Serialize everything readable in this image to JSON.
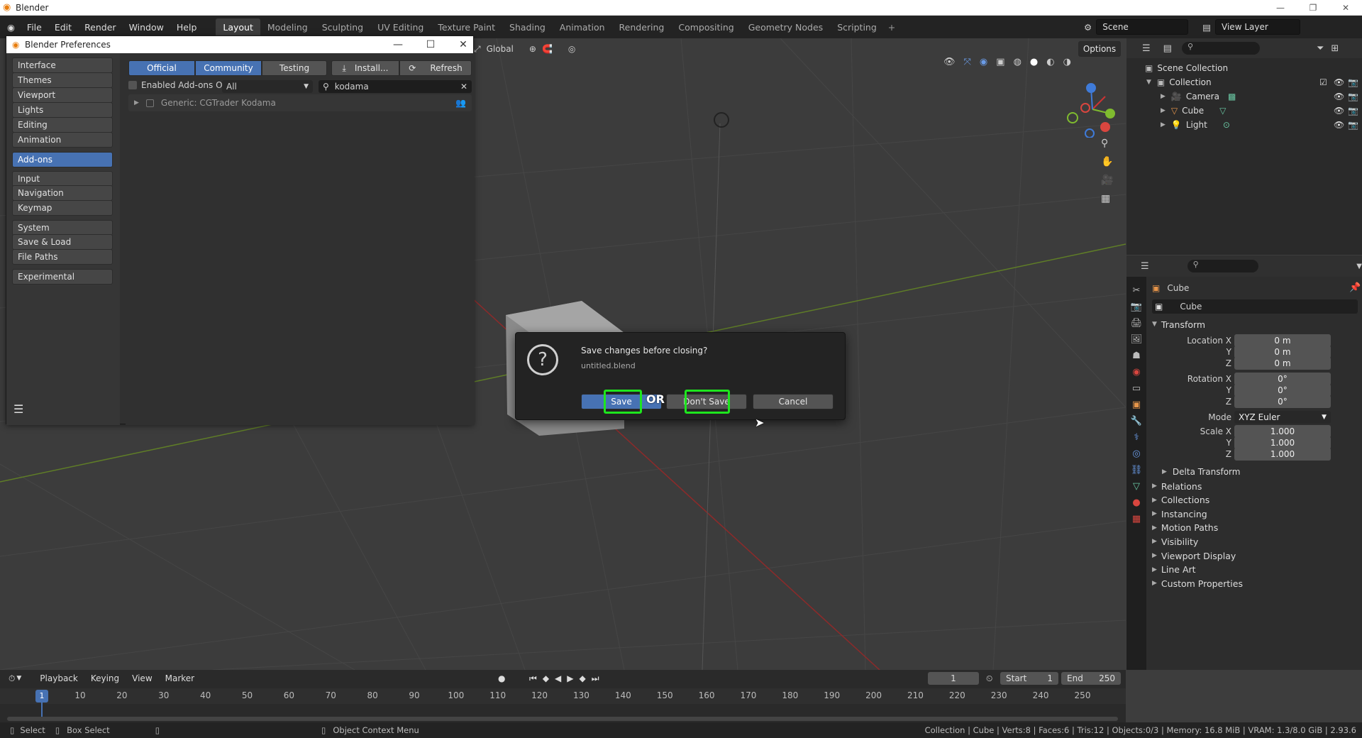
{
  "app": {
    "title": "Blender"
  },
  "menu": [
    "File",
    "Edit",
    "Render",
    "Window",
    "Help"
  ],
  "workspaces": [
    "Layout",
    "Modeling",
    "Sculpting",
    "UV Editing",
    "Texture Paint",
    "Shading",
    "Animation",
    "Rendering",
    "Compositing",
    "Geometry Nodes",
    "Scripting"
  ],
  "active_workspace": "Layout",
  "scene": {
    "name": "Scene",
    "view_layer": "View Layer"
  },
  "viewport_header": {
    "orientation": "Global",
    "options": "Options"
  },
  "preferences": {
    "title": "Blender Preferences",
    "sidebar": [
      {
        "label": "Interface"
      },
      {
        "label": "Themes"
      },
      {
        "label": "Viewport"
      },
      {
        "label": "Lights"
      },
      {
        "label": "Editing"
      },
      {
        "label": "Animation"
      },
      {
        "label": "Add-ons",
        "active": true
      },
      {
        "label": "Input"
      },
      {
        "label": "Navigation"
      },
      {
        "label": "Keymap"
      },
      {
        "label": "System"
      },
      {
        "label": "Save & Load"
      },
      {
        "label": "File Paths"
      },
      {
        "label": "Experimental"
      }
    ],
    "tabs": [
      "Official",
      "Community",
      "Testing"
    ],
    "install_label": "Install...",
    "refresh_label": "Refresh",
    "enabled_only_label": "Enabled Add-ons Only",
    "category_value": "All",
    "search_value": "kodama",
    "addon_item": "Generic: CGTrader Kodama"
  },
  "dialog": {
    "title": "Save changes before closing?",
    "file": "untitled.blend",
    "save_label": "Save",
    "or_label": "OR",
    "dont_save_label": "Don't Save",
    "cancel_label": "Cancel"
  },
  "outliner": {
    "root": "Scene Collection",
    "collection": "Collection",
    "items": [
      "Camera",
      "Cube",
      "Light"
    ]
  },
  "properties": {
    "object_name": "Cube",
    "data_name": "Cube",
    "transform_label": "Transform",
    "location_label": "Location X",
    "rotation_label": "Rotation X",
    "scale_label": "Scale X",
    "y_label": "Y",
    "z_label": "Z",
    "location": [
      "0 m",
      "0 m",
      "0 m"
    ],
    "rotation": [
      "0°",
      "0°",
      "0°"
    ],
    "mode_label": "Mode",
    "mode_value": "XYZ Euler",
    "scale": [
      "1.000",
      "1.000",
      "1.000"
    ],
    "delta_transform": "Delta Transform",
    "panels": [
      "Relations",
      "Collections",
      "Instancing",
      "Motion Paths",
      "Visibility",
      "Viewport Display",
      "Line Art",
      "Custom Properties"
    ]
  },
  "timeline": {
    "menus": [
      "Playback",
      "Keying",
      "View",
      "Marker"
    ],
    "current_frame": "1",
    "start_label": "Start",
    "start": "1",
    "end_label": "End",
    "end": "250",
    "ticks": [
      "1",
      "10",
      "20",
      "30",
      "40",
      "50",
      "60",
      "70",
      "80",
      "90",
      "100",
      "110",
      "120",
      "130",
      "140",
      "150",
      "160",
      "170",
      "180",
      "190",
      "200",
      "210",
      "220",
      "230",
      "240",
      "250"
    ]
  },
  "statusbar": {
    "select": "Select",
    "box_select": "Box Select",
    "context_menu": "Object Context Menu",
    "stats": "Collection | Cube | Verts:8 | Faces:6 | Tris:12 | Objects:0/3 | Memory: 16.8 MiB | VRAM: 1.3/8.0 GiB | 2.93.6"
  },
  "colors": {
    "accent": "#4772b3",
    "highlight": "#1ee61e",
    "x_axis": "#d9463f",
    "y_axis": "#7fbb2f",
    "z_axis": "#3f7bd9"
  }
}
